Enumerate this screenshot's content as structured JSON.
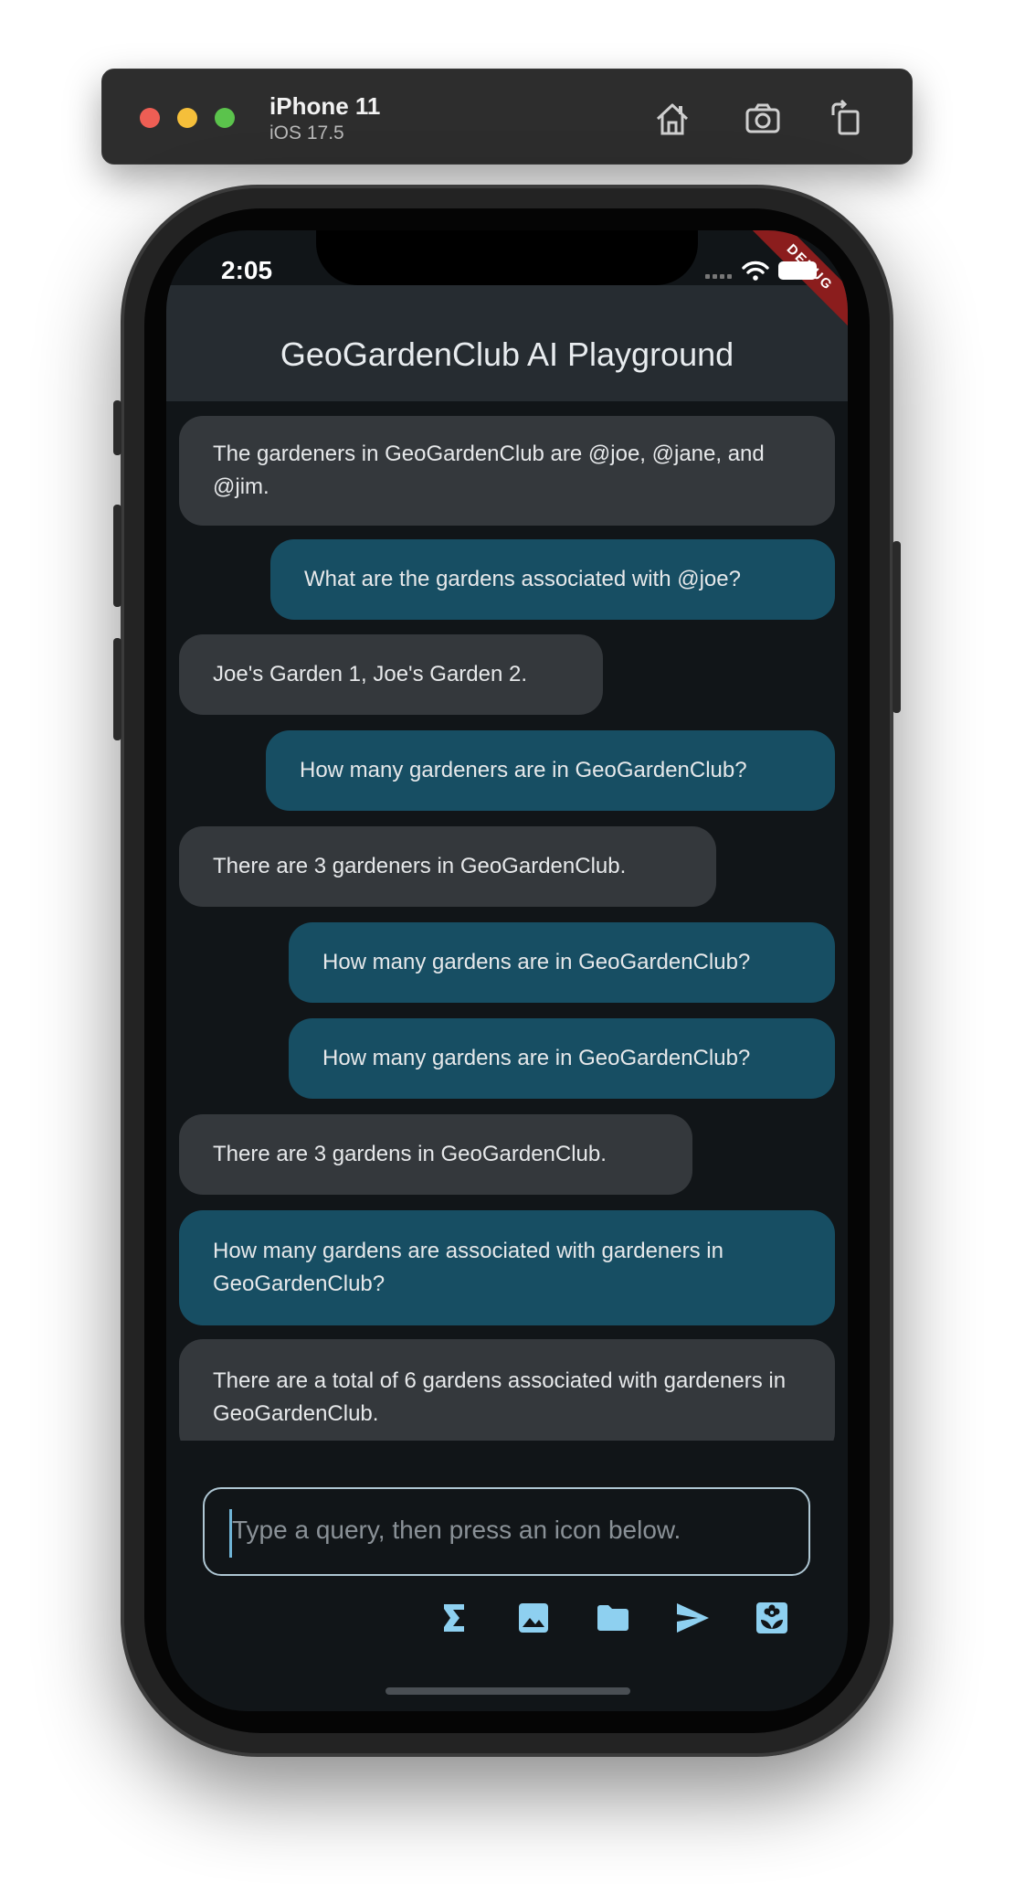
{
  "simulator": {
    "device": "iPhone 11",
    "os": "iOS 17.5",
    "buttons": [
      {
        "icon": "home-icon"
      },
      {
        "icon": "screenshot-icon"
      },
      {
        "icon": "rotate-icon"
      }
    ]
  },
  "status_bar": {
    "time": "2:05"
  },
  "debug_banner": "DEBUG",
  "app_bar": {
    "title": "GeoGardenClub AI Playground"
  },
  "messages": [
    {
      "role": "bot",
      "text": "The gardeners in GeoGardenClub are @joe, @jane, and @jim."
    },
    {
      "role": "user",
      "text": "What are the gardens associated with @joe?"
    },
    {
      "role": "bot",
      "text": "Joe's Garden 1, Joe's Garden 2."
    },
    {
      "role": "user",
      "text": "How many gardeners are in GeoGardenClub?"
    },
    {
      "role": "bot",
      "text": "There are 3 gardeners in GeoGardenClub."
    },
    {
      "role": "user",
      "text": "How many gardens are in GeoGardenClub?"
    },
    {
      "role": "user",
      "text": "How many gardens are in GeoGardenClub?"
    },
    {
      "role": "bot",
      "text": "There are 3 gardens in GeoGardenClub."
    },
    {
      "role": "user",
      "text": "How many gardens are associated with gardeners in GeoGardenClub?"
    },
    {
      "role": "bot",
      "text": "There are a total of 6 gardens associated with gardeners in GeoGardenClub."
    }
  ],
  "query_input": {
    "value": "",
    "placeholder": "Type a query, then press an icon below."
  },
  "actions": [
    {
      "icon": "sigma-icon"
    },
    {
      "icon": "image-icon"
    },
    {
      "icon": "folder-icon"
    },
    {
      "icon": "send-icon"
    },
    {
      "icon": "local-florist-icon"
    }
  ],
  "colors": {
    "app_bar": "#262c31",
    "background": "#111518",
    "bot_bubble": "#34383c",
    "user_bubble": "#174e63",
    "icon_accent": "#8ed0f0",
    "debug_banner": "#8b1d1d"
  }
}
